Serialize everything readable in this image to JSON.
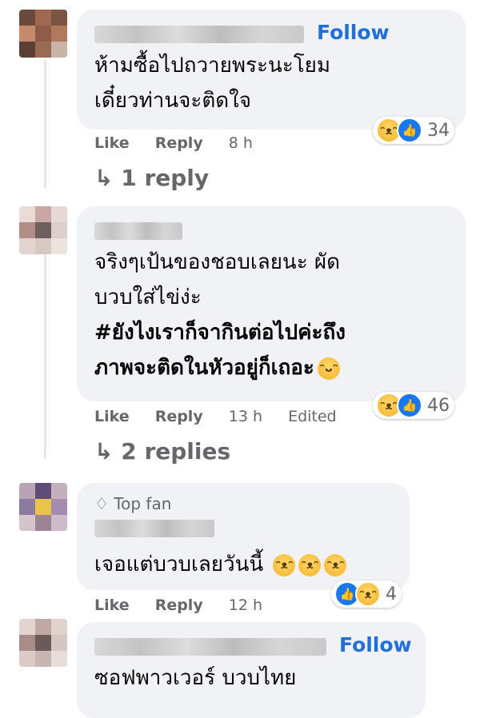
{
  "comments": [
    {
      "follow_label": "Follow",
      "lines": [
        "ห้ามซื้อไปถวายพระนะโยม",
        "เดี๋ยวท่านจะติดใจ"
      ],
      "like_label": "Like",
      "reply_label": "Reply",
      "time": "8 h",
      "reaction_count": "34",
      "replies_label": "↳ 1 reply"
    },
    {
      "lines": [
        "จริงๆเป้นของชอบเลยนะ ผัด",
        "บวบใส่ไข่ง่ะ"
      ],
      "bold_lines": [
        "#ยังไงเราก็จากินต่อไปค่ะถึง",
        "ภาพจะติดในหัวอยู่ก็เถอะ"
      ],
      "like_label": "Like",
      "reply_label": "Reply",
      "time": "13 h",
      "edited_label": "Edited",
      "reaction_count": "46",
      "replies_label": "↳ 2 replies"
    },
    {
      "badge_label": "Top fan",
      "lines": [
        "เจอแต่บวบเลยวันนี้"
      ],
      "like_label": "Like",
      "reply_label": "Reply",
      "time": "12 h",
      "reaction_count": "4"
    },
    {
      "follow_label": "Follow",
      "lines": [
        "ซอฟพาวเวอร์ บวบไทย"
      ]
    }
  ],
  "icons": {
    "haha": "haha-reaction-icon",
    "like": "like-reaction-icon",
    "diamond": "top-fan-diamond-icon"
  },
  "colors": {
    "link": "#216fdb",
    "bubble": "#f0f2f5",
    "meta": "#65676b",
    "like": "#1877f2"
  }
}
